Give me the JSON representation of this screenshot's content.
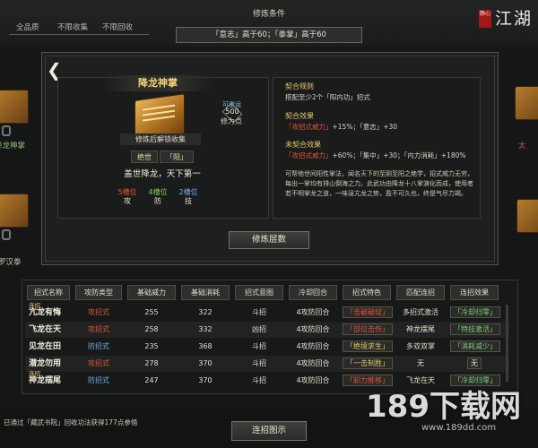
{
  "filters": [
    "全品质",
    "不限收集",
    "不限回收"
  ],
  "condition": {
    "title": "修炼条件",
    "requirement": "「意志」高于60；「拳掌」高于60"
  },
  "brand": {
    "seal": "静心",
    "title": "江湖"
  },
  "side_left": [
    "降龙神掌",
    "罗汉拳"
  ],
  "side_right": [
    "太"
  ],
  "skill": {
    "name": "降龙神掌",
    "unlock_tip": "修炼后解锁收集",
    "tags": [
      "绝世",
      "「阳」"
    ],
    "motto": "盖世降龙，天下第一",
    "points_label": "可激运",
    "points_value": "500",
    "points_text": "修为点",
    "stats": [
      {
        "value": "5槽位",
        "label": "攻",
        "color": "#e0523a"
      },
      {
        "value": "4槽位",
        "label": "防",
        "color": "#7fc96a"
      },
      {
        "value": "2槽位",
        "label": "技",
        "color": "#6fa8e8"
      }
    ]
  },
  "contract": {
    "rule_title": "契合规则",
    "rule_text": "搭配至少2个「阳内功」招式",
    "effect_title": "契合效果",
    "effect_line": [
      "「攻招式威力」",
      "+15%；「意志」+30"
    ],
    "miss_title": "未契合效果",
    "miss_line": [
      "「攻招式威力」",
      "+60%；「集中」+30；「内力消耗」+180%"
    ],
    "description": "可帮他世间阳性掌法，闻名天下的至刚至阳之绝学，招式威力无穷，每出一掌均有排山倒海之力。此武功由降龙十八掌演化而成，使用者若不明掌龙之道，一味逞亢龙之势，盈不可久也，终是气尽力竭。"
  },
  "practice_button": "修炼层数",
  "table": {
    "headers": [
      "招式名称",
      "攻防类型",
      "基础威力",
      "基础消耗",
      "招式意图",
      "冷却回合",
      "招式特色",
      "匹配连招",
      "连招效果"
    ],
    "rows": [
      {
        "badge": "连招",
        "name": "亢龙有悔",
        "type": "攻招式",
        "type_color": "#e0523a",
        "power": "255",
        "cost": "322",
        "intent": "斗招",
        "cd": "4攻防回合",
        "feature": "「击破破绽」",
        "feature_color": "#e0523a",
        "combo": "多招式激活",
        "effect": "「冷却归零」",
        "effect_color": "#7fd07a"
      },
      {
        "badge": "",
        "name": "飞龙在天",
        "type": "攻招式",
        "type_color": "#e0523a",
        "power": "258",
        "cost": "332",
        "intent": "凶招",
        "cd": "4攻防回合",
        "feature": "「部位击伤」",
        "feature_color": "#e0523a",
        "combo": "神龙摆尾",
        "effect": "「特技激活」",
        "effect_color": "#7fd07a"
      },
      {
        "badge": "",
        "name": "见龙在田",
        "type": "防招式",
        "type_color": "#6fa8e8",
        "power": "235",
        "cost": "368",
        "intent": "斗招",
        "cd": "4攻防回合",
        "feature": "「绝境求生」",
        "feature_color": "#e8c66a",
        "combo": "多双双掌",
        "effect": "「消耗减少」",
        "effect_color": "#7fd07a"
      },
      {
        "badge": "",
        "name": "潜龙勿用",
        "type": "攻招式",
        "type_color": "#e0523a",
        "power": "278",
        "cost": "370",
        "intent": "斗招",
        "cd": "4攻防回合",
        "feature": "「一击制胜」",
        "feature_color": "#e8c66a",
        "combo": "无",
        "effect": "无",
        "effect_color": "#e3ddd0"
      },
      {
        "badge": "连招",
        "name": "神龙摆尾",
        "type": "防招式",
        "type_color": "#6fa8e8",
        "power": "247",
        "cost": "370",
        "intent": "斗招",
        "cd": "4攻防回合",
        "feature": "「卸力推移」",
        "feature_color": "#e0523a",
        "combo": "飞龙在天",
        "effect": "「冷却归零」",
        "effect_color": "#7fd07a"
      }
    ]
  },
  "log": "已通过「藏武书院」回收功法获得177点参悟",
  "combo_button": "连招图示",
  "watermark": {
    "big": "189下载网",
    "small": "www.189dd.com"
  }
}
